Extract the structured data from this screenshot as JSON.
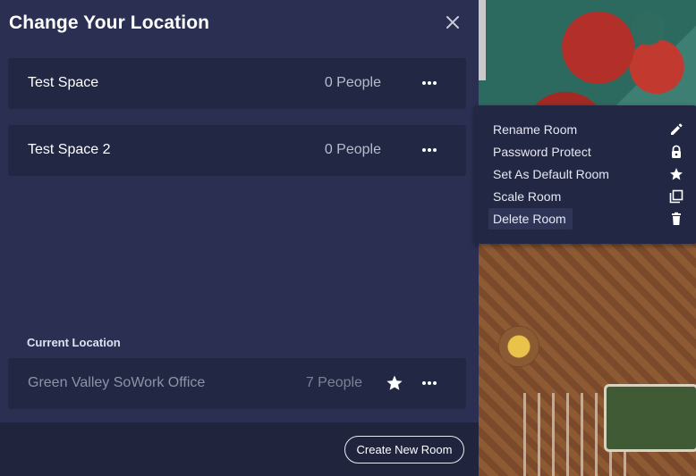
{
  "panel": {
    "title": "Change Your Location",
    "rooms": [
      {
        "name": "Test Space",
        "count": "0 People"
      },
      {
        "name": "Test Space 2",
        "count": "0 People"
      }
    ],
    "current_label": "Current Location",
    "current_room": {
      "name": "Green Valley SoWork Office",
      "count": "7 People"
    },
    "create_button": "Create New Room"
  },
  "context_menu": {
    "items": [
      {
        "label": "Rename Room",
        "icon": "pencil-icon"
      },
      {
        "label": "Password Protect",
        "icon": "lock-icon"
      },
      {
        "label": "Set As Default Room",
        "icon": "star-icon"
      },
      {
        "label": "Scale Room",
        "icon": "copy-icon"
      },
      {
        "label": "Delete Room",
        "icon": "trash-icon"
      }
    ]
  },
  "colors": {
    "panel_bg": "#2b3053",
    "card_bg": "#222744",
    "footer_bg": "#20243d",
    "text_muted": "#b8bccd"
  }
}
